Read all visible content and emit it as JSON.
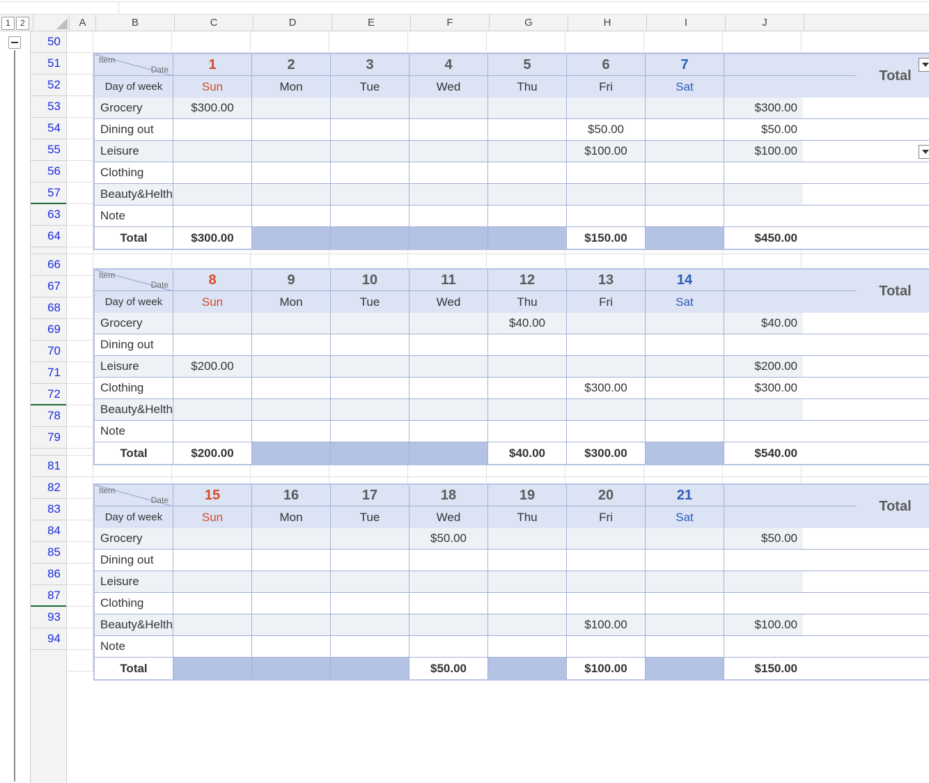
{
  "labels": {
    "group_btn_1": "1",
    "group_btn_2": "2",
    "item": "Item",
    "date": "Date",
    "day_of_week": "Day of week",
    "total": "Total",
    "note": "Note"
  },
  "columns": [
    "A",
    "B",
    "C",
    "D",
    "E",
    "F",
    "G",
    "H",
    "I",
    "J"
  ],
  "rownums": [
    50,
    51,
    52,
    53,
    54,
    55,
    56,
    57,
    63,
    64,
    "",
    66,
    67,
    68,
    69,
    70,
    71,
    72,
    78,
    79,
    "",
    81,
    82,
    83,
    84,
    85,
    86,
    87,
    93,
    94
  ],
  "days_short": [
    "Sun",
    "Mon",
    "Tue",
    "Wed",
    "Thu",
    "Fri",
    "Sat"
  ],
  "categories": [
    "Grocery",
    "Dining out",
    "Leisure",
    "Clothing",
    "Beauty&Helth"
  ],
  "weeks": [
    {
      "dates": [
        "1",
        "2",
        "3",
        "4",
        "5",
        "6",
        "7"
      ],
      "rows": {
        "Grocery": [
          "$300.00",
          "",
          "",
          "",
          "",
          "",
          ""
        ],
        "Dining out": [
          "",
          "",
          "",
          "",
          "",
          "$50.00",
          ""
        ],
        "Leisure": [
          "",
          "",
          "",
          "",
          "",
          "$100.00",
          ""
        ],
        "Clothing": [
          "",
          "",
          "",
          "",
          "",
          "",
          ""
        ],
        "Beauty&Helth": [
          "",
          "",
          "",
          "",
          "",
          "",
          ""
        ]
      },
      "row_totals": {
        "Grocery": "$300.00",
        "Dining out": "$50.00",
        "Leisure": "$100.00",
        "Clothing": "",
        "Beauty&Helth": ""
      },
      "col_totals": [
        "$300.00",
        "",
        "",
        "",
        "",
        "$150.00",
        ""
      ],
      "grand_total": "$450.00"
    },
    {
      "dates": [
        "8",
        "9",
        "10",
        "11",
        "12",
        "13",
        "14"
      ],
      "rows": {
        "Grocery": [
          "",
          "",
          "",
          "",
          "$40.00",
          "",
          ""
        ],
        "Dining out": [
          "",
          "",
          "",
          "",
          "",
          "",
          ""
        ],
        "Leisure": [
          "$200.00",
          "",
          "",
          "",
          "",
          "",
          ""
        ],
        "Clothing": [
          "",
          "",
          "",
          "",
          "",
          "$300.00",
          ""
        ],
        "Beauty&Helth": [
          "",
          "",
          "",
          "",
          "",
          "",
          ""
        ]
      },
      "row_totals": {
        "Grocery": "$40.00",
        "Dining out": "",
        "Leisure": "$200.00",
        "Clothing": "$300.00",
        "Beauty&Helth": ""
      },
      "col_totals": [
        "$200.00",
        "",
        "",
        "",
        "$40.00",
        "$300.00",
        ""
      ],
      "grand_total": "$540.00"
    },
    {
      "dates": [
        "15",
        "16",
        "17",
        "18",
        "19",
        "20",
        "21"
      ],
      "rows": {
        "Grocery": [
          "",
          "",
          "",
          "$50.00",
          "",
          "",
          ""
        ],
        "Dining out": [
          "",
          "",
          "",
          "",
          "",
          "",
          ""
        ],
        "Leisure": [
          "",
          "",
          "",
          "",
          "",
          "",
          ""
        ],
        "Clothing": [
          "",
          "",
          "",
          "",
          "",
          "",
          ""
        ],
        "Beauty&Helth": [
          "",
          "",
          "",
          "",
          "",
          "$100.00",
          ""
        ]
      },
      "row_totals": {
        "Grocery": "$50.00",
        "Dining out": "",
        "Leisure": "",
        "Clothing": "",
        "Beauty&Helth": "$100.00"
      },
      "col_totals": [
        "",
        "",
        "",
        "$50.00",
        "",
        "$100.00",
        ""
      ],
      "grand_total": "$150.00"
    }
  ]
}
